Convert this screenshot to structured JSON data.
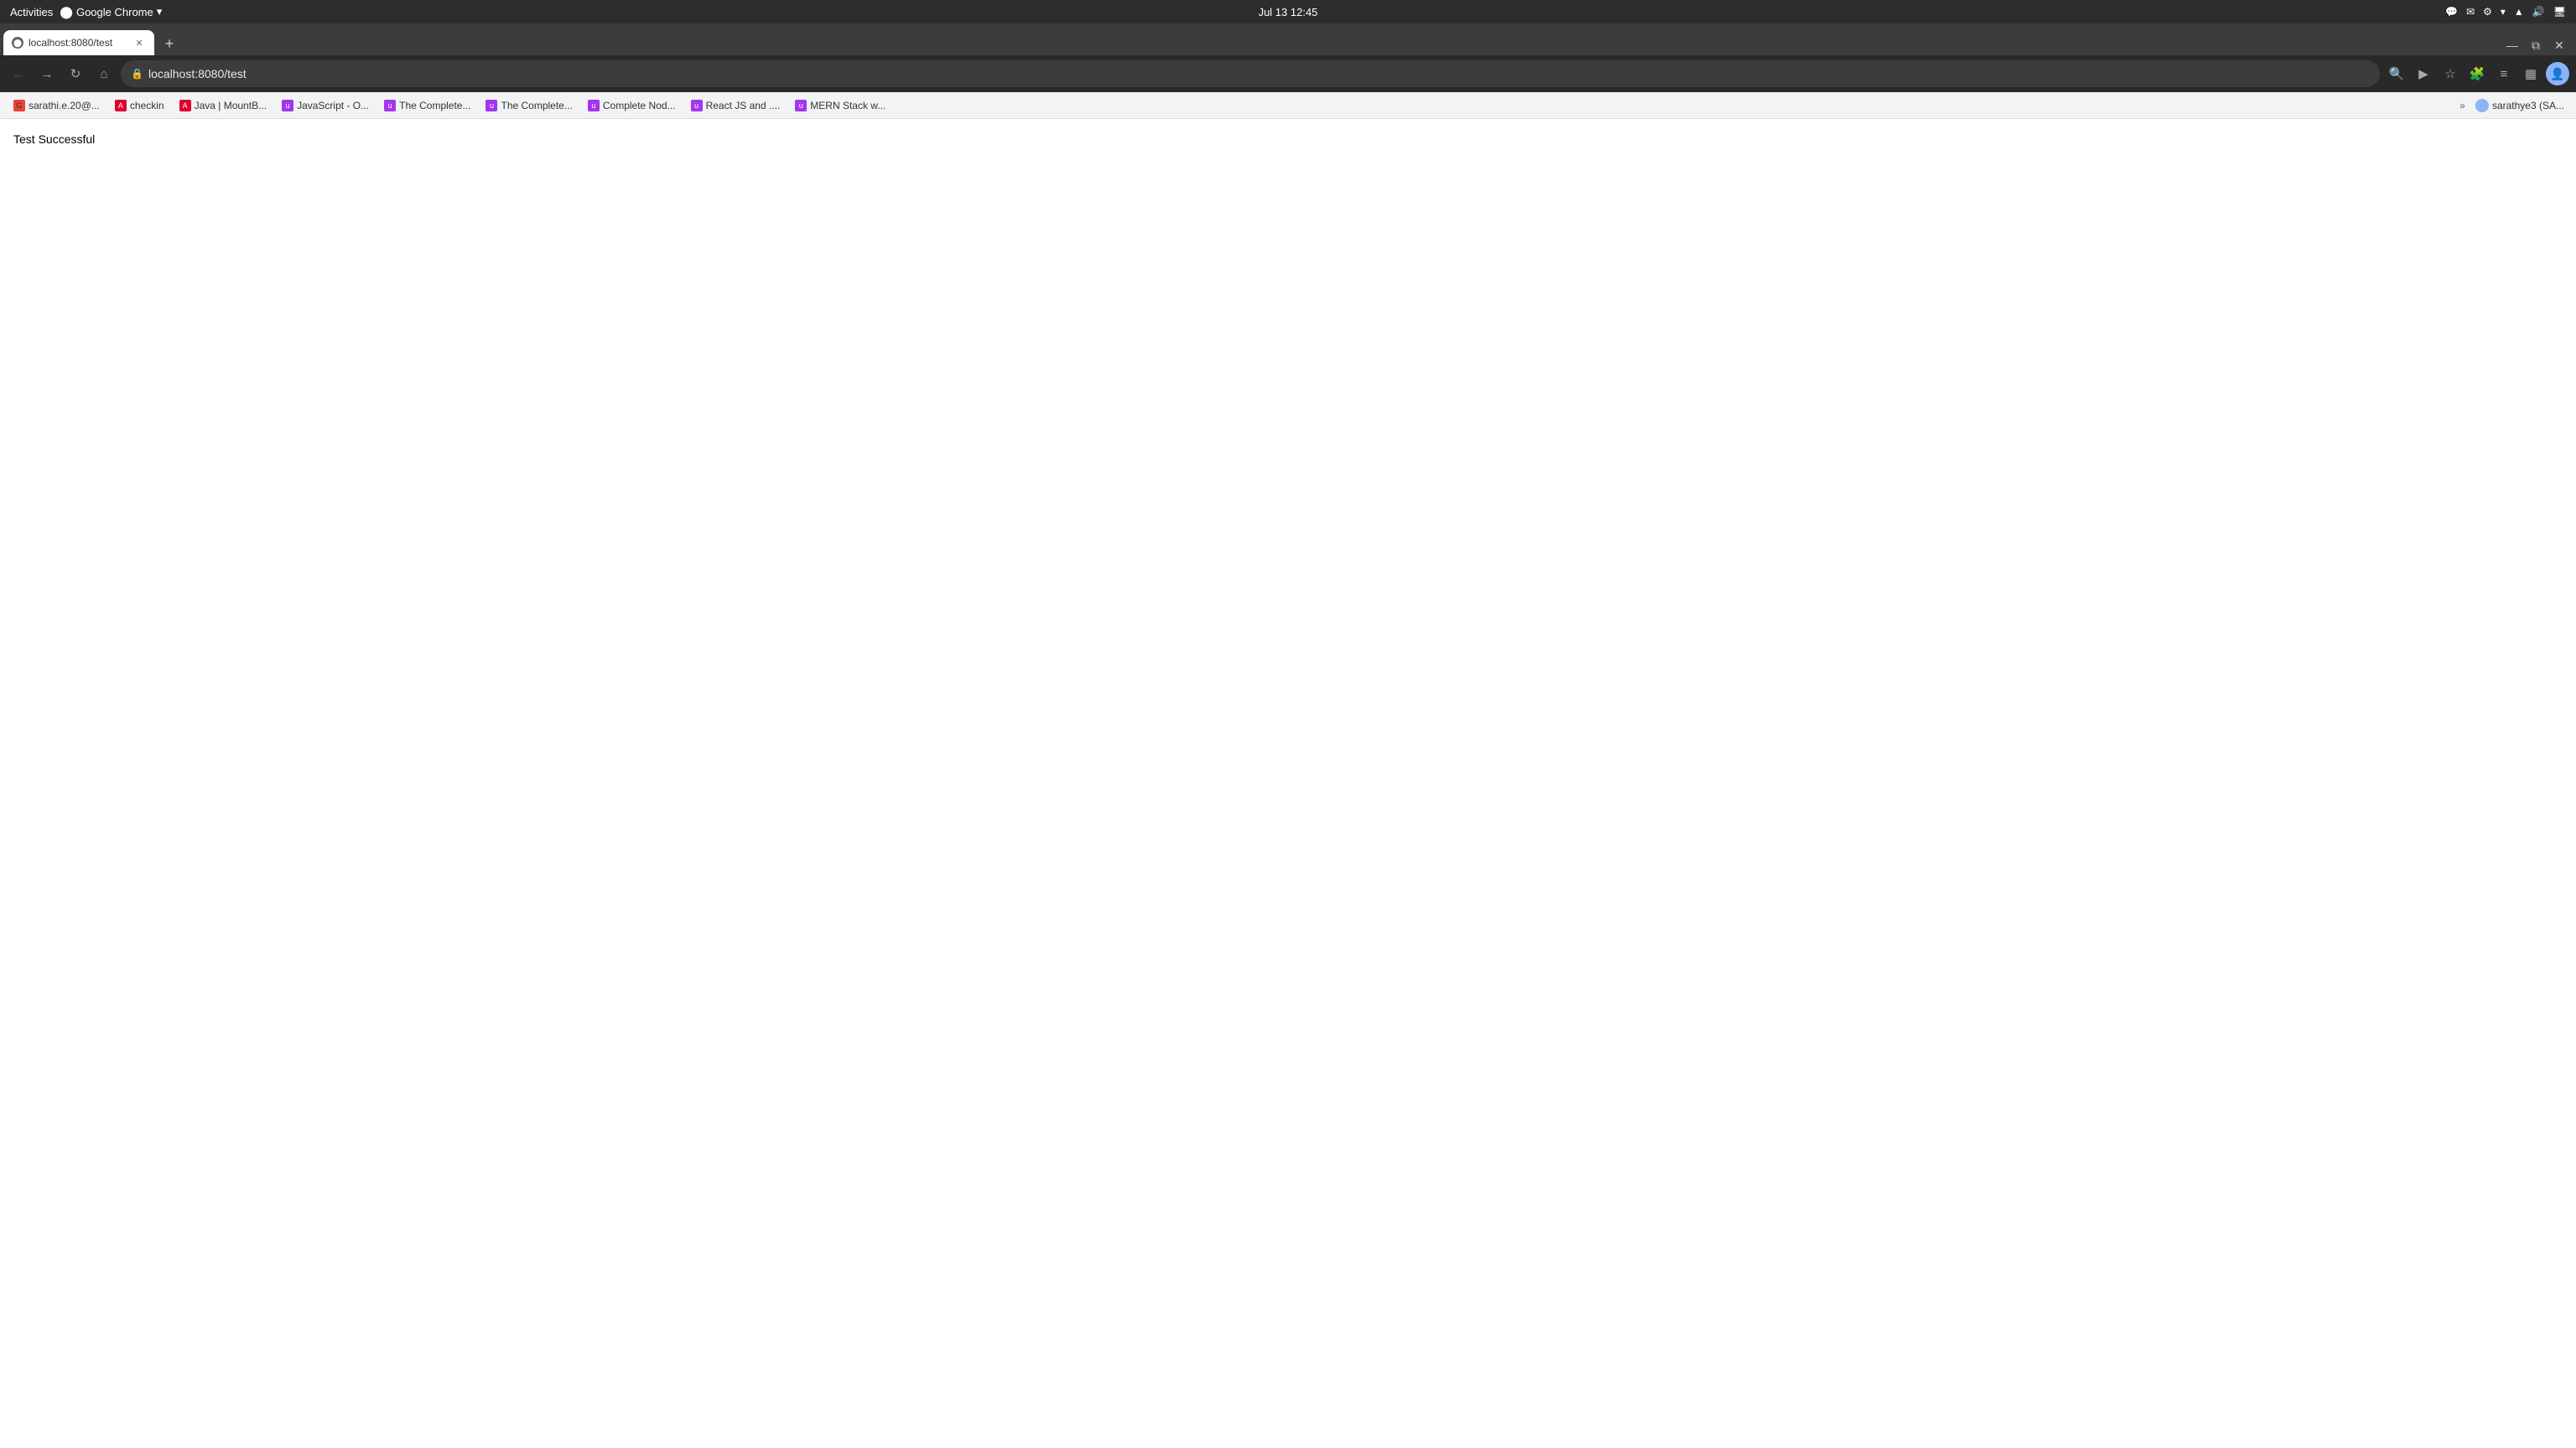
{
  "os": {
    "activities": "Activities",
    "browser": "Google Chrome",
    "time": "Jul 13  12:45"
  },
  "chrome": {
    "tab": {
      "title": "localhost:8080/test",
      "favicon": "●"
    },
    "new_tab_label": "+"
  },
  "addressbar": {
    "url": "localhost:8080/test"
  },
  "bookmarks": [
    {
      "id": "sarathi",
      "label": "sarathi.e.20@...",
      "icon_color": "#ea4335",
      "icon_char": "G"
    },
    {
      "id": "checkin",
      "label": "checkin",
      "icon_color": "#dd0031",
      "icon_char": "A"
    },
    {
      "id": "java",
      "label": "Java | MountB...",
      "icon_color": "#dd0031",
      "icon_char": "A"
    },
    {
      "id": "javascript",
      "label": "JavaScript - O...",
      "icon_color": "#a435f0",
      "icon_char": "u"
    },
    {
      "id": "complete1",
      "label": "The Complete...",
      "icon_color": "#a435f0",
      "icon_char": "u"
    },
    {
      "id": "complete2",
      "label": "The Complete...",
      "icon_color": "#a435f0",
      "icon_char": "u"
    },
    {
      "id": "node",
      "label": "Complete Nod...",
      "icon_color": "#a435f0",
      "icon_char": "u"
    },
    {
      "id": "react",
      "label": "React JS and ....",
      "icon_color": "#a435f0",
      "icon_char": "u"
    },
    {
      "id": "mern",
      "label": "MERN Stack w...",
      "icon_color": "#a435f0",
      "icon_char": "u"
    }
  ],
  "profile": {
    "label": "sarathye3 (SA..."
  },
  "page": {
    "content": "Test Successful"
  }
}
